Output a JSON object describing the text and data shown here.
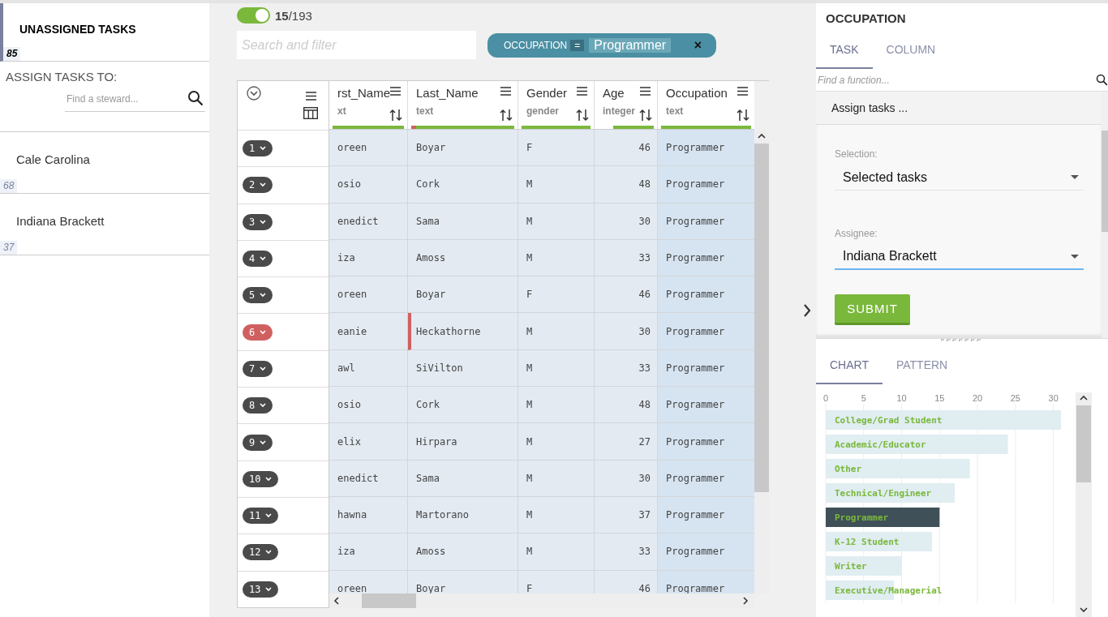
{
  "left_panel": {
    "unassigned": {
      "title": "UNASSIGNED TASKS",
      "count": "85",
      "selected": true
    },
    "assign_label": "ASSIGN TASKS TO:",
    "steward_search": {
      "placeholder": "Find a steward..."
    },
    "stewards": [
      {
        "name": "Cale Carolina",
        "count": "68",
        "selected": false
      },
      {
        "name": "Indiana Brackett",
        "count": "37",
        "selected": false
      }
    ]
  },
  "toolbar": {
    "toggle": {
      "on": true
    },
    "count": "**15**/193",
    "search": {
      "placeholder": "Search and filter"
    },
    "filter_chip": {
      "field": "OCCUPATION",
      "operator": "=",
      "value": "Programmer",
      "remove": "×"
    }
  },
  "table": {
    "columns": [
      {
        "name": "rst_Name",
        "type": "xt",
        "level": 1,
        "errors": false
      },
      {
        "name": "Last_Name",
        "type": "text",
        "level": 0.95,
        "errors": true
      },
      {
        "name": "Gender",
        "type": "gender",
        "level": 1,
        "errors": false
      },
      {
        "name": "Age",
        "type": "integer",
        "level": 0.72,
        "errors": false
      },
      {
        "name": "Occupation",
        "type": "text",
        "level": 1,
        "errors": false
      }
    ],
    "rows": [
      {
        "num": "1",
        "flagged": false,
        "cells": [
          "oreen",
          "Boyar",
          "F",
          "46",
          "Programmer"
        ]
      },
      {
        "num": "2",
        "flagged": false,
        "cells": [
          "osio",
          "Cork",
          "M",
          "48",
          "Programmer"
        ]
      },
      {
        "num": "3",
        "flagged": false,
        "cells": [
          "enedict",
          "Sama",
          "M",
          "30",
          "Programmer"
        ]
      },
      {
        "num": "4",
        "flagged": false,
        "cells": [
          "iza",
          "Amoss",
          "M",
          "33",
          "Programmer"
        ]
      },
      {
        "num": "5",
        "flagged": false,
        "cells": [
          "oreen",
          "Boyar",
          "F",
          "46",
          "Programmer"
        ]
      },
      {
        "num": "6",
        "flagged": true,
        "cells": [
          "eanie",
          "Heckathorne",
          "M",
          "30",
          "Programmer"
        ]
      },
      {
        "num": "7",
        "flagged": false,
        "cells": [
          "awl",
          "SiVilton",
          "M",
          "33",
          "Programmer"
        ]
      },
      {
        "num": "8",
        "flagged": false,
        "cells": [
          "osio",
          "Cork",
          "M",
          "48",
          "Programmer"
        ]
      },
      {
        "num": "9",
        "flagged": false,
        "cells": [
          "elix",
          "Hirpara",
          "M",
          "27",
          "Programmer"
        ]
      },
      {
        "num": "10",
        "flagged": false,
        "cells": [
          "enedict",
          "Sama",
          "M",
          "30",
          "Programmer"
        ]
      },
      {
        "num": "11",
        "flagged": false,
        "cells": [
          "hawna",
          "Martorano",
          "M",
          "37",
          "Programmer"
        ]
      },
      {
        "num": "12",
        "flagged": false,
        "cells": [
          "iza",
          "Amoss",
          "M",
          "33",
          "Programmer"
        ]
      },
      {
        "num": "13",
        "flagged": false,
        "cells": [
          "oreen",
          "Boyar",
          "F",
          "46",
          "Programmer"
        ]
      }
    ]
  },
  "right_panel": {
    "title": "OCCUPATION",
    "tabs": [
      {
        "label": "TASK",
        "selected": true
      },
      {
        "label": "COLUMN",
        "selected": false
      }
    ],
    "function_search": {
      "placeholder": "Find a function..."
    },
    "section": {
      "title": "Assign tasks ...",
      "fields": [
        {
          "label": "Selection:",
          "value": "Selected tasks",
          "focused": false
        },
        {
          "label": "Assignee:",
          "value": "Indiana Brackett",
          "focused": true
        }
      ],
      "submit": "SUBMIT"
    },
    "bottom_tabs": [
      {
        "label": "CHART",
        "selected": true
      },
      {
        "label": "PATTERN",
        "selected": false
      }
    ],
    "chart": {
      "bar_selected": [
        false,
        false,
        false,
        false,
        true,
        false,
        false,
        false
      ],
      "chart_data": {
        "type": "bar",
        "orientation": "horizontal",
        "categories": [
          "College/Grad Student",
          "Academic/Educator",
          "Other",
          "Technical/Engineer",
          "Programmer",
          "K-12 Student",
          "Writer",
          "Executive/Managerial"
        ],
        "values": [
          31,
          24,
          19,
          17,
          15,
          14,
          10,
          9
        ],
        "xlim": [
          0,
          31
        ],
        "xticks": [
          0,
          5,
          10,
          15,
          20,
          25,
          30
        ],
        "grid": true
      }
    }
  }
}
